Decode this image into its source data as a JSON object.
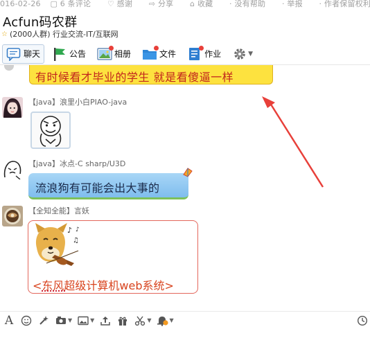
{
  "meta_strip": {
    "date": "016-02-26",
    "comments": "6 条评论",
    "thanks": "感谢",
    "share": "分享",
    "favorite": "收藏",
    "no_help": "没有帮助",
    "report": "举报",
    "copyright": "作者保留权利"
  },
  "header": {
    "group_name": "Acfun码农群",
    "group_info": "(2000人群) 行业交流-IT/互联网"
  },
  "toolbar": {
    "tabs": [
      {
        "label": "聊天",
        "icon": "chat-icon",
        "active": true
      },
      {
        "label": "公告",
        "icon": "flag-icon"
      },
      {
        "label": "相册",
        "icon": "photo-icon"
      },
      {
        "label": "文件",
        "icon": "folder-icon"
      },
      {
        "label": "作业",
        "icon": "homework-icon"
      }
    ],
    "settings_icon": "gear-icon"
  },
  "messages": [
    {
      "text": "有时候看才毕业的学生 就是看傻逼一样",
      "bubble": "yellow",
      "text_color": "#c2251d",
      "bubble_color": "#fde23f"
    },
    {
      "sender": "【java】浪里小白PIAO-java",
      "content": "sticker",
      "icon": "meme-face-icon"
    },
    {
      "sender": "【java】冰点-C sharp/U3D",
      "text": "流浪狗有可能会出大事的",
      "bubble": "blue",
      "bubble_color": "#8fc8f2"
    },
    {
      "sender": "【全知全能】言妖",
      "text": "<东风超级计算机web系统>",
      "bubble": "red",
      "text_color": "#d8431e",
      "image": "doge-violin-icon"
    }
  ],
  "input_toolbar": {
    "icons": [
      "font-icon",
      "emoji-icon",
      "magic-icon",
      "screenshot-icon",
      "image-icon",
      "upload-icon",
      "gift-icon",
      "scissors-icon",
      "bell-icon",
      "history-icon"
    ]
  },
  "colors": {
    "accent_arrow": "#e8403a",
    "star": "#e2a500"
  }
}
